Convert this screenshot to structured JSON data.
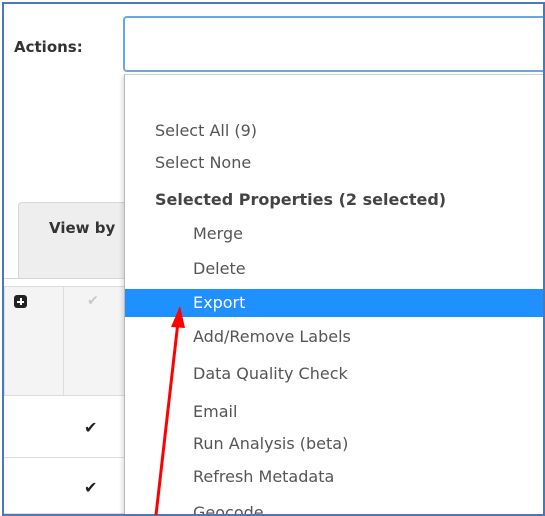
{
  "actions": {
    "label": "Actions:",
    "select_value": ""
  },
  "tabs": [
    {
      "label": "View by"
    }
  ],
  "table": {
    "rows": [
      {
        "checked": true
      },
      {
        "checked": true
      }
    ]
  },
  "dropdown": {
    "options": [
      {
        "label": "Select All (9)",
        "type": "option"
      },
      {
        "label": "Select None",
        "type": "option"
      },
      {
        "label": "Selected Properties (2 selected)",
        "type": "header"
      },
      {
        "label": "Merge",
        "type": "suboption"
      },
      {
        "label": "Delete",
        "type": "suboption"
      },
      {
        "label": "Export",
        "type": "suboption",
        "highlighted": true
      },
      {
        "label": "Add/Remove Labels",
        "type": "suboption"
      },
      {
        "label": "Data Quality Check",
        "type": "suboption"
      },
      {
        "label": "Email",
        "type": "suboption"
      },
      {
        "label": "Run Analysis (beta)",
        "type": "suboption"
      },
      {
        "label": "Refresh Metadata",
        "type": "suboption"
      },
      {
        "label": "Geocode",
        "type": "suboption"
      }
    ]
  },
  "colors": {
    "highlight": "#1e90ff",
    "frame_border": "#4a78b8",
    "select_border": "#6aa7e0",
    "annotation_arrow": "#ff0000"
  },
  "icons": {
    "expand": "plus-square-icon",
    "check": "checkmark-icon"
  }
}
